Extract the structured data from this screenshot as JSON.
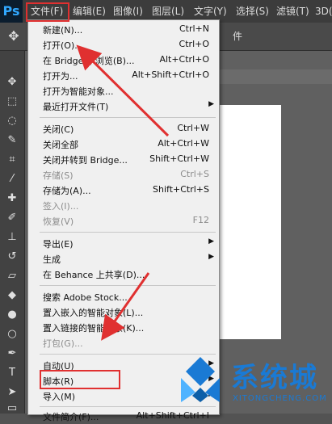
{
  "app": {
    "logo": "Ps"
  },
  "menubar": {
    "items": [
      {
        "label": "文件(F)"
      },
      {
        "label": "编辑(E)"
      },
      {
        "label": "图像(I)"
      },
      {
        "label": "图层(L)"
      },
      {
        "label": "文字(Y)"
      },
      {
        "label": "选择(S)"
      },
      {
        "label": "滤镜(T)"
      },
      {
        "label": "3D("
      }
    ]
  },
  "options_bar": {
    "label_fragment": "件"
  },
  "file_menu": {
    "items": [
      {
        "label": "新建(N)...",
        "shortcut": "Ctrl+N"
      },
      {
        "label": "打开(O)...",
        "shortcut": "Ctrl+O"
      },
      {
        "label": "在 Bridge 中浏览(B)...",
        "shortcut": "Alt+Ctrl+O"
      },
      {
        "label": "打开为...",
        "shortcut": "Alt+Shift+Ctrl+O"
      },
      {
        "label": "打开为智能对象...",
        "shortcut": ""
      },
      {
        "label": "最近打开文件(T)",
        "shortcut": ""
      },
      {
        "label": "关闭(C)",
        "shortcut": "Ctrl+W"
      },
      {
        "label": "关闭全部",
        "shortcut": "Alt+Ctrl+W"
      },
      {
        "label": "关闭并转到 Bridge...",
        "shortcut": "Shift+Ctrl+W"
      },
      {
        "label": "存储(S)",
        "shortcut": "Ctrl+S"
      },
      {
        "label": "存储为(A)...",
        "shortcut": "Shift+Ctrl+S"
      },
      {
        "label": "签入(I)...",
        "shortcut": ""
      },
      {
        "label": "恢复(V)",
        "shortcut": "F12"
      },
      {
        "label": "导出(E)",
        "shortcut": ""
      },
      {
        "label": "生成",
        "shortcut": ""
      },
      {
        "label": "在 Behance 上共享(D)...",
        "shortcut": ""
      },
      {
        "label": "搜索 Adobe Stock...",
        "shortcut": ""
      },
      {
        "label": "置入嵌入的智能对象(L)...",
        "shortcut": ""
      },
      {
        "label": "置入链接的智能对象(K)...",
        "shortcut": ""
      },
      {
        "label": "打包(G)...",
        "shortcut": ""
      },
      {
        "label": "自动(U)",
        "shortcut": ""
      },
      {
        "label": "脚本(R)",
        "shortcut": ""
      },
      {
        "label": "导入(M)",
        "shortcut": ""
      },
      {
        "label": "文件简介(F)...",
        "shortcut": "Alt+Shift+Ctrl+I"
      }
    ]
  },
  "watermark": {
    "text": "系统城",
    "sub": "XITONGCHENG.COM"
  },
  "colors": {
    "highlight": "#e03030",
    "arrow": "#e03030",
    "brand": "#1a7ad4"
  }
}
